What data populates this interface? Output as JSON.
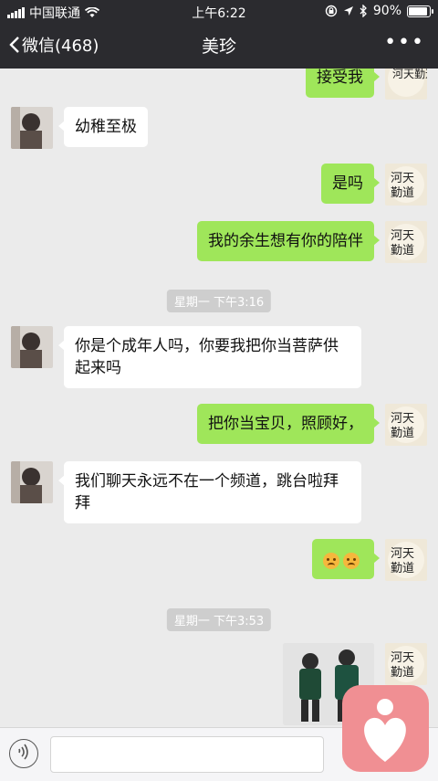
{
  "status_bar": {
    "carrier": "中国联通",
    "time": "上午6:22",
    "battery": "90%",
    "icons": [
      "signal-icon",
      "wifi-icon",
      "lock-rotation-icon",
      "location-icon",
      "bluetooth-icon",
      "battery-icon"
    ]
  },
  "nav": {
    "back_label": "微信(468)",
    "title": "美珍",
    "more_label": "•••"
  },
  "messages": [
    {
      "side": "out",
      "text": "接受我",
      "partial": true
    },
    {
      "side": "in",
      "text": "幼稚至极"
    },
    {
      "side": "out",
      "text": "是吗"
    },
    {
      "side": "out",
      "text": "我的余生想有你的陪伴"
    },
    {
      "type": "timestamp",
      "text": "星期一 下午3:16"
    },
    {
      "side": "in",
      "text": "你是个成年人吗，你要我把你当菩萨供起来吗"
    },
    {
      "side": "out",
      "text": "把你当宝贝，照顾好，"
    },
    {
      "side": "in",
      "text": "我们聊天永远不在一个频道，跳台啦拜拜"
    },
    {
      "side": "out",
      "type": "emoji",
      "emoji": [
        "frowning-face",
        "frowning-face"
      ]
    },
    {
      "type": "timestamp",
      "text": "星期一 下午3:53"
    },
    {
      "side": "out",
      "type": "image",
      "description_icon": "photo-thumbnail"
    }
  ],
  "sender_avatar_text": "河天勤道",
  "colors": {
    "header_bg": "#2b2b2f",
    "chat_bg": "#ebebeb",
    "out_bubble": "#9fe65a",
    "in_bubble": "#ffffff",
    "timestamp_bg": "#cecece",
    "floating_app": "#f08f93"
  }
}
